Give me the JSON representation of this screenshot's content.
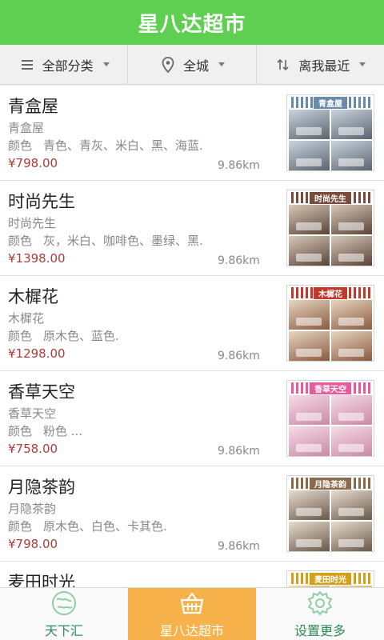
{
  "header": {
    "title": "星八达超市"
  },
  "filters": [
    {
      "label": "全部分类",
      "icon": "menu-icon"
    },
    {
      "label": "全城",
      "icon": "location-pin-icon"
    },
    {
      "label": "离我最近",
      "icon": "sort-icon"
    }
  ],
  "colors_label": "颜色",
  "items": [
    {
      "name": "青盒屋",
      "subtitle": "青盒屋",
      "colors": "青色、青灰、米白、黑、海蓝.",
      "price": "¥798.00",
      "distance": "9.86km",
      "banner": "青盒屋",
      "band": "#6a8aa8",
      "c1": "#c9d4de",
      "c2": "#5b6470"
    },
    {
      "name": "时尚先生",
      "subtitle": "时尚先生",
      "colors": "灰，米白、咖啡色、墨绿、黑.",
      "price": "¥1398.00",
      "distance": "9.86km",
      "banner": "时尚先生",
      "band": "#7a4a3a",
      "c1": "#d8c8b8",
      "c2": "#5a4438"
    },
    {
      "name": "木樨花",
      "subtitle": "木樨花",
      "colors": "原木色、蓝色.",
      "price": "¥1298.00",
      "distance": "9.86km",
      "banner": "木樨花",
      "band": "#c0392b",
      "c1": "#e8d6c0",
      "c2": "#8a5a40"
    },
    {
      "name": "香草天空",
      "subtitle": "香草天空",
      "colors": "粉色 ...",
      "price": "¥758.00",
      "distance": "9.86km",
      "banner": "香草天空",
      "band": "#e85a9c",
      "c1": "#f6dbe6",
      "c2": "#c98aa6"
    },
    {
      "name": "月隐茶韵",
      "subtitle": "月隐茶韵",
      "colors": "原木色、白色、卡其色.",
      "price": "¥798.00",
      "distance": "9.86km",
      "banner": "月隐茶韵",
      "band": "#8a6a4a",
      "c1": "#e8ddd0",
      "c2": "#6a5848"
    },
    {
      "name": "麦田时光",
      "subtitle": "",
      "colors": "",
      "price": "",
      "distance": "",
      "banner": "麦田时光",
      "band": "#d4a017",
      "c1": "#f0e0b0",
      "c2": "#9a7a30"
    }
  ],
  "tabs": [
    {
      "label": "天下汇",
      "icon": "globe-icon",
      "active": false
    },
    {
      "label": "星八达超市",
      "icon": "shopping-basket-icon",
      "active": true
    },
    {
      "label": "设置更多",
      "icon": "gear-icon",
      "active": false
    }
  ]
}
